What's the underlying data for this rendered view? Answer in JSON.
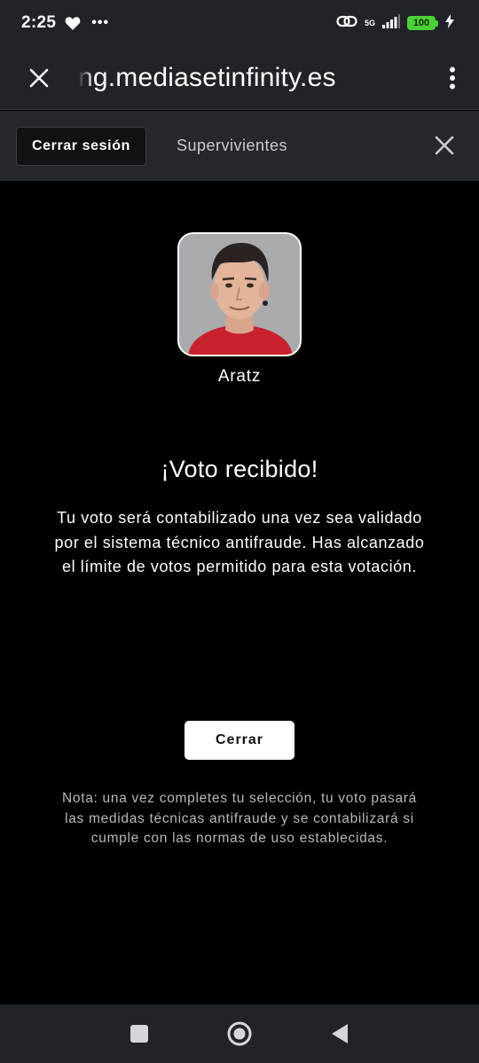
{
  "status_bar": {
    "time": "2:25",
    "dots": "•••",
    "network": "5G",
    "battery": "100",
    "battery_color": "#4cd137"
  },
  "browser": {
    "url": "ng.mediasetinfinity.es"
  },
  "site_header": {
    "logout_label": "Cerrar sesión",
    "section_title": "Supervivientes"
  },
  "candidate": {
    "name": "Aratz"
  },
  "confirmation": {
    "title": "¡Voto recibido!",
    "message": "Tu voto será contabilizado una vez sea validado por el sistema técnico antifraude. Has alcanzado el límite de votos permitido para esta votación.",
    "close_label": "Cerrar",
    "note": "Nota: una vez completes tu selección, tu voto pasará las medidas técnicas antifraude y se contabilizará si cumple con las normas de uso establecidas."
  },
  "nav_bar": {
    "icons": [
      "recents-icon",
      "home-icon",
      "back-icon"
    ]
  }
}
